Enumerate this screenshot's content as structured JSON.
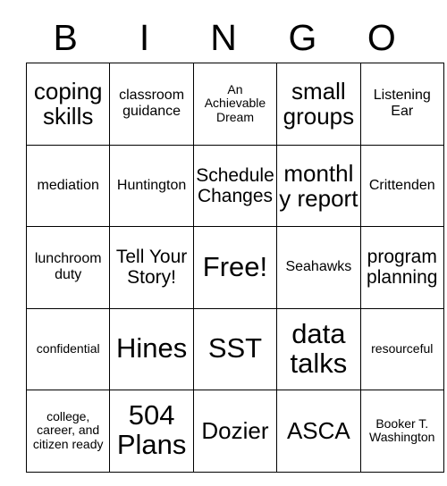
{
  "card": {
    "type": "bingo-card",
    "header_letters": [
      "B",
      "I",
      "N",
      "G",
      "O"
    ],
    "columns": 5,
    "rows": 5,
    "free_space": {
      "row": 3,
      "column": 3,
      "label": "Free!"
    },
    "grid": [
      [
        {
          "text": "coping skills",
          "size": "xl"
        },
        {
          "text": "classroom guidance",
          "size": "m"
        },
        {
          "text": "An Achievable Dream",
          "size": "s"
        },
        {
          "text": "small groups",
          "size": "xl"
        },
        {
          "text": "Listening Ear",
          "size": "m"
        }
      ],
      [
        {
          "text": "mediation",
          "size": "m"
        },
        {
          "text": "Huntington",
          "size": "m"
        },
        {
          "text": "Schedule Changes",
          "size": "l"
        },
        {
          "text": "monthly report",
          "size": "xl"
        },
        {
          "text": "Crittenden",
          "size": "m"
        }
      ],
      [
        {
          "text": "lunchroom duty",
          "size": "m"
        },
        {
          "text": "Tell Your Story!",
          "size": "l"
        },
        {
          "text": "Free!",
          "size": "free"
        },
        {
          "text": "Seahawks",
          "size": "m"
        },
        {
          "text": "program planning",
          "size": "l"
        }
      ],
      [
        {
          "text": "confidential",
          "size": "s"
        },
        {
          "text": "Hines",
          "size": "xxl"
        },
        {
          "text": "SST",
          "size": "xxl"
        },
        {
          "text": "data talks",
          "size": "xxl"
        },
        {
          "text": "resourceful",
          "size": "s"
        }
      ],
      [
        {
          "text": "college, career, and citizen ready",
          "size": "s"
        },
        {
          "text": "504 Plans",
          "size": "xxl"
        },
        {
          "text": "Dozier",
          "size": "xl"
        },
        {
          "text": "ASCA",
          "size": "xl"
        },
        {
          "text": "Booker T. Washington",
          "size": "s"
        }
      ]
    ]
  },
  "colors": {
    "background": "#ffffff",
    "text": "#000000",
    "grid_line": "#000000"
  }
}
